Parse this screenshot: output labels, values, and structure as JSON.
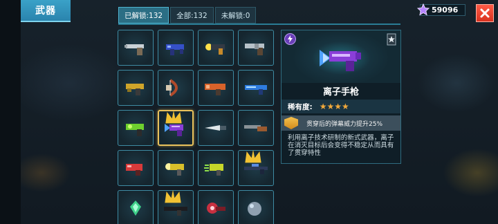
{
  "header": {
    "title": "武器"
  },
  "tabs": [
    {
      "label": "已解锁:132",
      "active": true
    },
    {
      "label": "全部:132",
      "active": false
    },
    {
      "label": "未解锁:0",
      "active": false
    }
  ],
  "currency": {
    "amount": "59096",
    "icon": "purple-star-gem-icon"
  },
  "close_icon": "close-icon",
  "weapons": [
    {
      "icon": "silver-revolver-icon",
      "selected": false,
      "crown": false
    },
    {
      "icon": "blue-smg-icon",
      "selected": false,
      "crown": false
    },
    {
      "icon": "energy-blaster-icon",
      "selected": false,
      "crown": false
    },
    {
      "icon": "heavy-revolver-icon",
      "selected": false,
      "crown": false
    },
    {
      "icon": "gold-pistol-icon",
      "selected": false,
      "crown": false
    },
    {
      "icon": "bow-icon",
      "selected": false,
      "crown": false
    },
    {
      "icon": "orange-launcher-icon",
      "selected": false,
      "crown": false
    },
    {
      "icon": "blue-laser-rifle-icon",
      "selected": false,
      "crown": false
    },
    {
      "icon": "green-toxic-gun-icon",
      "selected": false,
      "crown": false
    },
    {
      "icon": "ion-pistol-icon",
      "selected": true,
      "crown": true
    },
    {
      "icon": "dagger-icon",
      "selected": false,
      "crown": false
    },
    {
      "icon": "shotgun-icon",
      "selected": false,
      "crown": false
    },
    {
      "icon": "red-blaster-icon",
      "selected": false,
      "crown": false
    },
    {
      "icon": "yellow-gatling-icon",
      "selected": false,
      "crown": false
    },
    {
      "icon": "sonic-gun-icon",
      "selected": false,
      "crown": false
    },
    {
      "icon": "sniper-rifle-icon",
      "selected": false,
      "crown": true
    },
    {
      "icon": "green-crystal-icon",
      "selected": false,
      "crown": false
    },
    {
      "icon": "black-rifle-icon",
      "selected": false,
      "crown": true
    },
    {
      "icon": "red-cannon-icon",
      "selected": false,
      "crown": false
    },
    {
      "icon": "stone-orb-icon",
      "selected": false,
      "crown": false
    }
  ],
  "detail": {
    "element_icon": "lightning-element-icon",
    "rank_icon": "rank-badge-icon",
    "name": "离子手枪",
    "rarity_label": "稀有度:",
    "stars": "★★★★",
    "rarity_value": 4,
    "perk_text": "贯穿后的弹幕威力提升25%",
    "description": "利用离子技术研制的新式武器，离子在消灭目标后会变得不稳定从而具有了贯穿特性"
  },
  "colors": {
    "accent": "#2a84ad",
    "selected_border": "#e9c25c",
    "close_red": "#e23f2b",
    "star_gold": "#f2a93b"
  }
}
